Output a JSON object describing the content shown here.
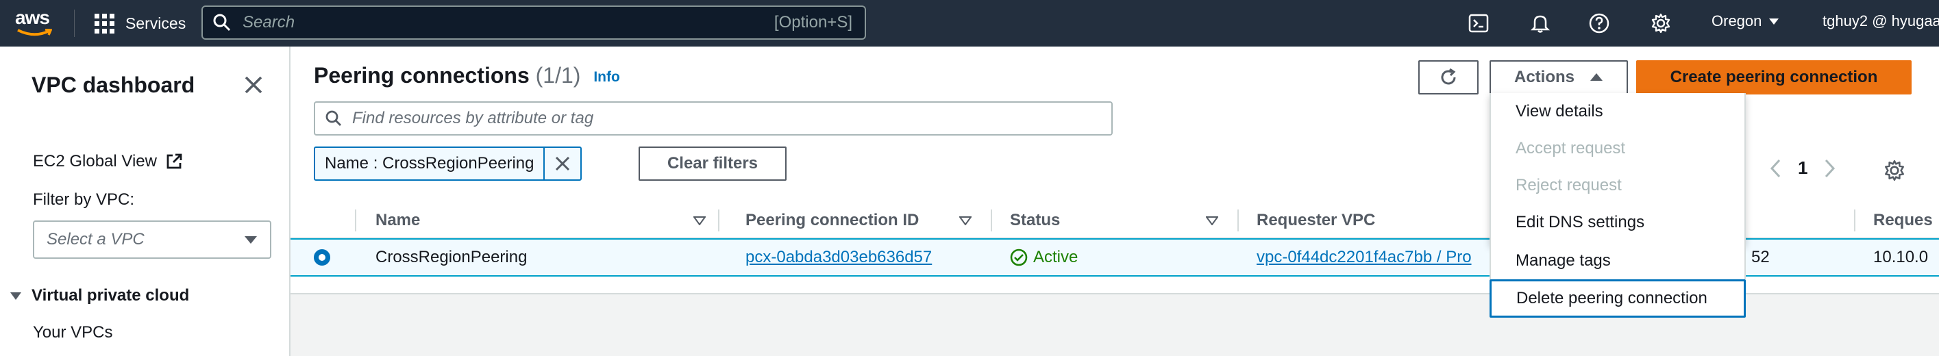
{
  "topbar": {
    "logo_text": "aws",
    "services_label": "Services",
    "search_placeholder": "Search",
    "search_shortcut": "[Option+S]",
    "region_label": "Oregon",
    "user_label": "tghuy2 @ hyugaa"
  },
  "sidebar": {
    "title": "VPC dashboard",
    "global_view_link": "EC2 Global View",
    "filter_label": "Filter by VPC:",
    "filter_placeholder": "Select a VPC",
    "section_label": "Virtual private cloud",
    "items": [
      "Your VPCs"
    ]
  },
  "main": {
    "title": "Peering connections",
    "count": "(1/1)",
    "info_link": "Info",
    "filter_placeholder": "Find resources by attribute or tag",
    "filter_token": "Name : CrossRegionPeering",
    "clear_filters_label": "Clear filters",
    "actions_label": "Actions",
    "create_label": "Create peering connection",
    "page_number": "1"
  },
  "table": {
    "columns": [
      "Name",
      "Peering connection ID",
      "Status",
      "Requester VPC",
      "Reques"
    ],
    "rows": [
      {
        "name": "CrossRegionPeering",
        "peering_id": "pcx-0abda3d03eb636d57",
        "status": "Active",
        "requester_vpc": "vpc-0f44dc2201f4ac7bb / Pro",
        "hidden_col_fragment": "52",
        "requester_cidr": "10.10.0"
      }
    ]
  },
  "actions_menu": {
    "items": [
      {
        "label": "View details",
        "enabled": true
      },
      {
        "label": "Accept request",
        "enabled": false
      },
      {
        "label": "Reject request",
        "enabled": false
      },
      {
        "label": "Edit DNS settings",
        "enabled": true
      },
      {
        "label": "Manage tags",
        "enabled": true
      },
      {
        "label": "Delete peering connection",
        "enabled": true
      }
    ]
  },
  "colors": {
    "topbar_bg": "#232f3e",
    "primary_orange": "#ec7211",
    "link_blue": "#0073bb",
    "status_green": "#1d8102"
  }
}
